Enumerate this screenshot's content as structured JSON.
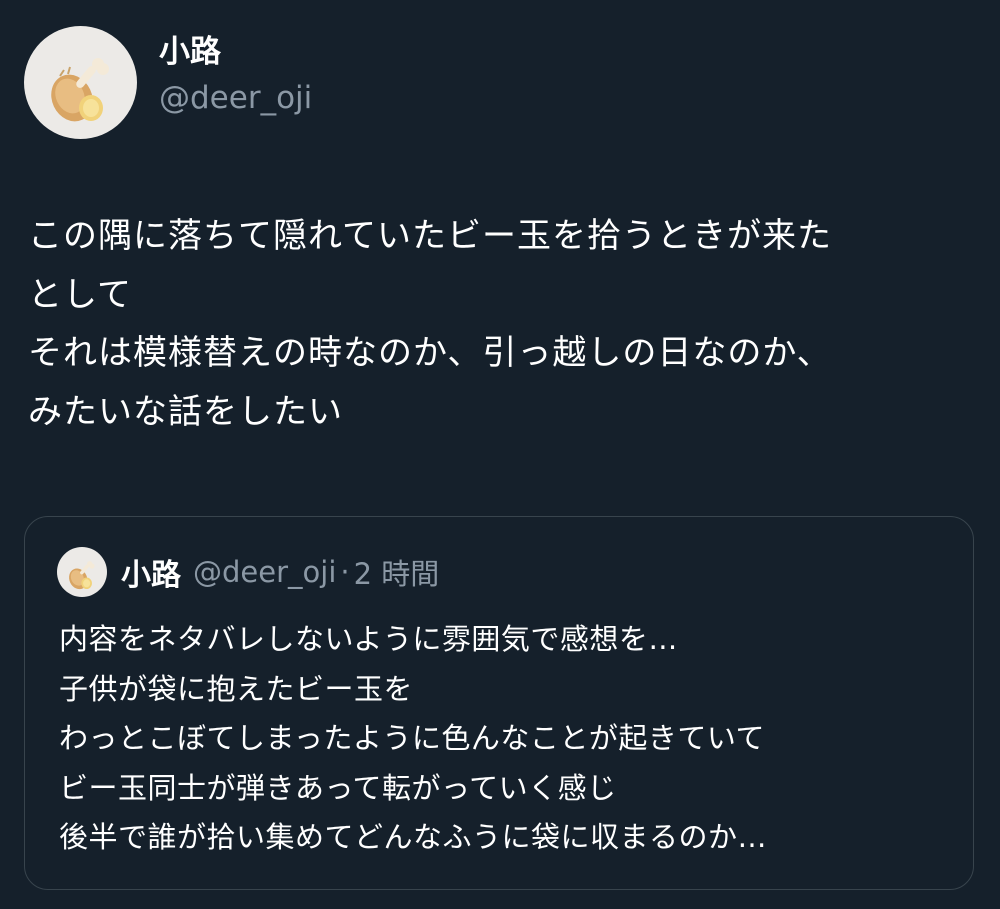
{
  "tweet": {
    "author": {
      "display_name": "小路",
      "handle": "@deer_oji",
      "avatar_icon": "fried-chicken-avatar-icon"
    },
    "body_lines": [
      "この隅に落ちて隠れていたビー玉を拾うときが来た",
      "として",
      "それは模様替えの時なのか、引っ越しの日なのか、",
      "みたいな話をしたい"
    ]
  },
  "quoted_tweet": {
    "author": {
      "display_name": "小路",
      "handle": "@deer_oji",
      "avatar_icon": "fried-chicken-avatar-icon"
    },
    "separator": "·",
    "time": "2 時間",
    "body_lines": [
      "内容をネタバレしないように雰囲気で感想を…",
      "子供が袋に抱えたビー玉を",
      "わっとこぼてしまったように色んなことが起きていて",
      "ビー玉同士が弾きあって転がっていく感じ",
      "後半で誰が拾い集めてどんなふうに袋に収まるのか…"
    ]
  },
  "colors": {
    "background": "#15202b",
    "text_primary": "#ffffff",
    "text_secondary": "#8b98a5",
    "border": "#38444d",
    "avatar_bg": "#eceae7"
  }
}
